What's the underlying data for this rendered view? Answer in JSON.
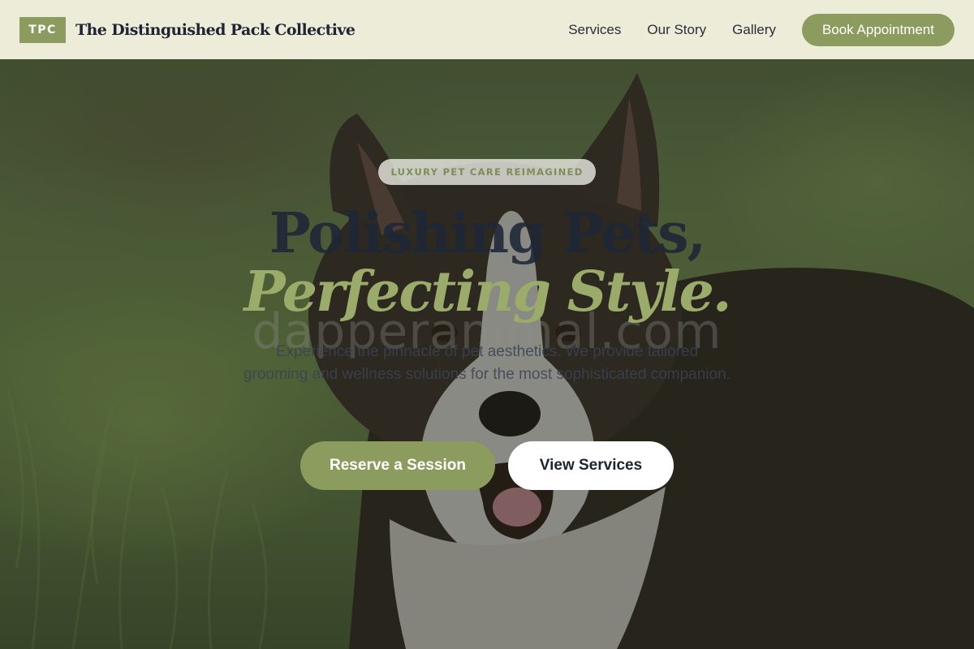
{
  "nav": {
    "logo_text": "TPC",
    "brand_name": "The Distinguished Pack Collective",
    "links": [
      "Services",
      "Our Story",
      "Gallery"
    ],
    "cta_label": "Book Appointment"
  },
  "hero": {
    "eyebrow": "LUXURY PET CARE REIMAGINED",
    "headline_line1": "Polishing Pets,",
    "headline_line2": "Perfecting Style.",
    "watermark": "dapperanimal.com",
    "subtitle": "Experience the pinnacle of pet aesthetics. We provide tailored grooming and wellness solutions for the most sophisticated companion.",
    "primary_button": "Reserve a Session",
    "secondary_button": "View Services",
    "background_image": "border-collie-in-grass-photo"
  },
  "colors": {
    "accent_green": "#8c9c5f",
    "nav_background": "#ececd9",
    "headline_dark": "#1e2637",
    "headline_green": "#9aab6a"
  }
}
